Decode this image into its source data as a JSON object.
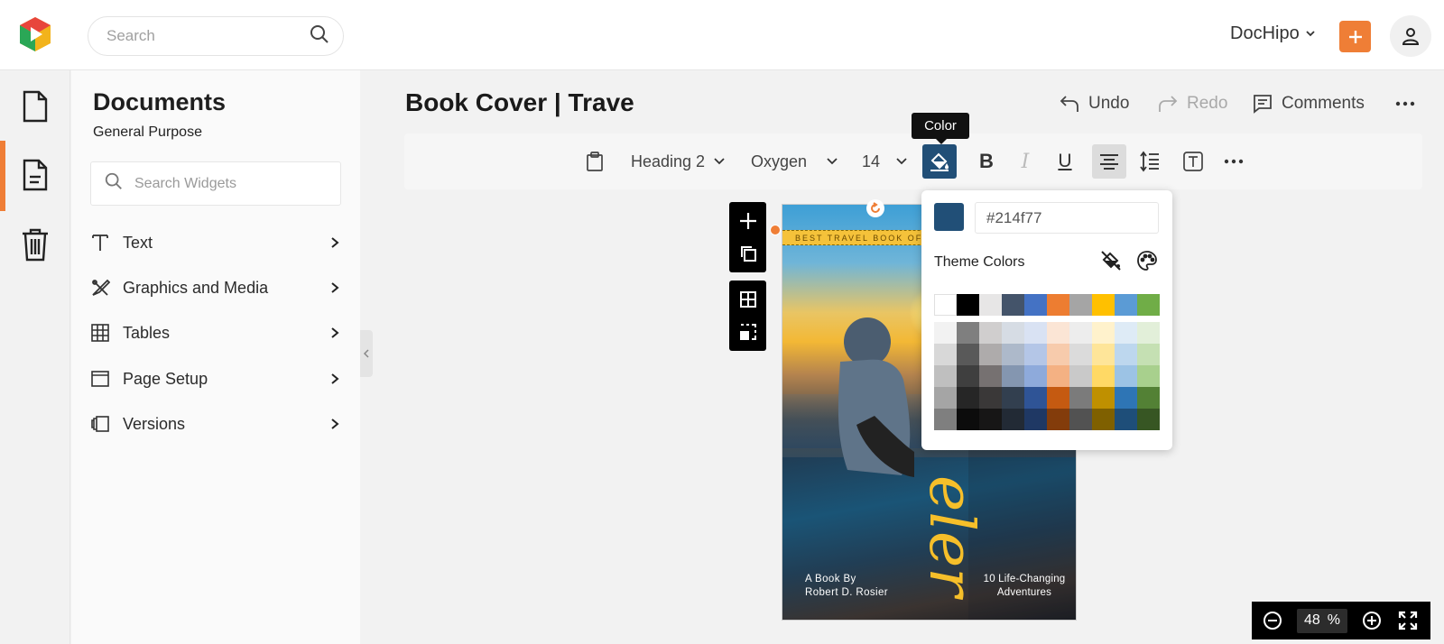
{
  "topbar": {
    "search_placeholder": "Search",
    "brand": "DocHipo"
  },
  "panel": {
    "title": "Documents",
    "subtitle": "General Purpose",
    "search_placeholder": "Search Widgets",
    "items": [
      {
        "label": "Text",
        "icon": "text-icon"
      },
      {
        "label": "Graphics and Media",
        "icon": "graphics-icon"
      },
      {
        "label": "Tables",
        "icon": "table-icon"
      },
      {
        "label": "Page Setup",
        "icon": "page-setup-icon"
      },
      {
        "label": "Versions",
        "icon": "versions-icon"
      }
    ]
  },
  "doc": {
    "title": "Book Cover | Trave",
    "undo": "Undo",
    "redo": "Redo",
    "comments": "Comments"
  },
  "toolbar": {
    "style": "Heading 2",
    "font": "Oxygen",
    "size": "14",
    "tooltip": "Color",
    "bold": "B",
    "italic": "I",
    "underline": "U"
  },
  "cover": {
    "banner": "BEST TRAVEL BOOK OF TH",
    "script": "eler",
    "byline_1": "A Book By",
    "byline_2": "Robert D. Rosier",
    "tagline_1": "10 Life-Changing",
    "tagline_2": "Adventures"
  },
  "color_popup": {
    "current": "#214f77",
    "hex_value": "#214f77",
    "theme_label": "Theme Colors",
    "base_colors": [
      "#ffffff",
      "#000000",
      "#e7e6e6",
      "#44546a",
      "#4472c4",
      "#ed7d31",
      "#a5a5a5",
      "#ffc000",
      "#5b9bd5",
      "#70ad47"
    ],
    "shades": [
      [
        "#f2f2f2",
        "#7f7f7f",
        "#d0cece",
        "#d6dce4",
        "#d9e2f3",
        "#fbe5d5",
        "#ededed",
        "#fff2cc",
        "#deebf6",
        "#e2efd9"
      ],
      [
        "#d8d8d8",
        "#595959",
        "#aeabab",
        "#adb9ca",
        "#b4c6e7",
        "#f7cbac",
        "#dbdbdb",
        "#fee599",
        "#bdd7ee",
        "#c5e0b3"
      ],
      [
        "#bfbfbf",
        "#3f3f3f",
        "#767171",
        "#8496b0",
        "#8eaadb",
        "#f4b183",
        "#c9c9c9",
        "#ffd965",
        "#9cc3e5",
        "#a8d08d"
      ],
      [
        "#a5a5a5",
        "#262626",
        "#3a3838",
        "#323f4f",
        "#2f5496",
        "#c55a11",
        "#7b7b7b",
        "#bf9000",
        "#2e75b5",
        "#538135"
      ],
      [
        "#7f7f7f",
        "#0c0c0c",
        "#171616",
        "#222a35",
        "#1f3864",
        "#833c0b",
        "#525252",
        "#7f6000",
        "#1e4e79",
        "#375623"
      ]
    ]
  },
  "zoom": {
    "value": "48",
    "unit": "%"
  }
}
